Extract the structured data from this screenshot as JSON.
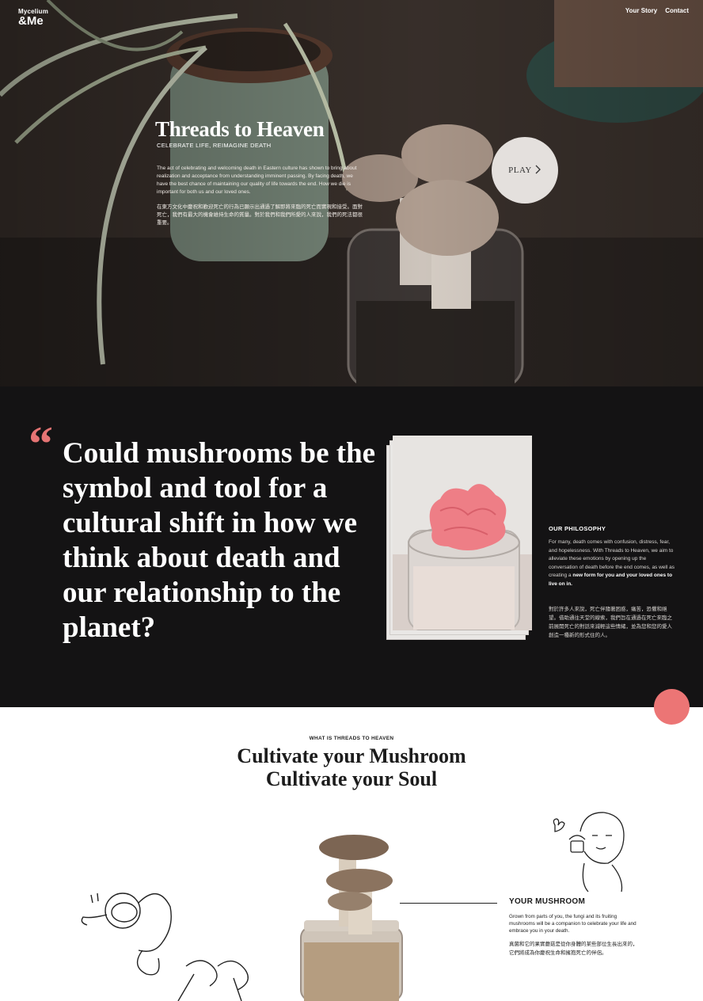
{
  "header": {
    "brand_small": "Mycelium",
    "brand_big": "&Me",
    "nav": [
      "Your Story",
      "Contact"
    ]
  },
  "hero": {
    "title": "Threads to Heaven",
    "subtitle": "CELEBRATE LIFE, REIMAGINE DEATH",
    "body": "The act of celebrating and welcoming death in Eastern culture has shown to bring about realization and acceptance from understanding imminent passing. By facing death, we have the best chance of maintaining our quality of life towards the end. How we die is important for both us and our loved ones.",
    "body_zh": "在東方文化中慶祝和歡迎死亡的行為已顯示出通過了解即將來臨的死亡而實現和接受。面對死亡，我們有最大的機會維持生命的質量。對於我們和我們所愛的人來說，我們的死法都很重要。",
    "play_label": "PLAY",
    "play_icon": "chevron-right-icon"
  },
  "philosophy": {
    "quote_mark": "“",
    "quote": "Could mushrooms be the symbol and tool for a cultural shift in how we think about death and our relationship to the planet?",
    "title": "OUR PHILOSOPHY",
    "body": "For many, death comes with confusion, distress, fear, and hopelessness. With Threads to Heaven, we aim to alleviate these emotions by opening up the conversation of death before the end comes, as well as creating a ",
    "body_bold": "new form for you and your loved ones to live on in.",
    "body_zh": "對於許多人來說，死亡伴隨著困惑，痛苦，恐懼和絕望。借助通往天堂的線索，我們旨在通過在死亡來臨之前展開死亡的對話來減輕這些情緒，並為您和您的愛人創造一種新的形式住的人。"
  },
  "cultivate": {
    "label": "WHAT IS THREADS TO HEAVEN",
    "line1": "Cultivate your Mushroom",
    "line2": "Cultivate your Soul"
  },
  "your_mushroom": {
    "title": "YOUR MUSHROOM",
    "body": "Grown from parts of you, the fungi and its fruiting mushrooms will be a companion to celebrate your life and embrace you in your death.",
    "body_zh": "真菌和它的果實蘑菇是從你身體的某些部位生長出來的，它們將成為你慶祝生命和擁抱死亡的伴侶。"
  },
  "colors": {
    "accent": "#ec7575",
    "dark_bg": "#141314",
    "play_bg": "#e4e0dd"
  }
}
